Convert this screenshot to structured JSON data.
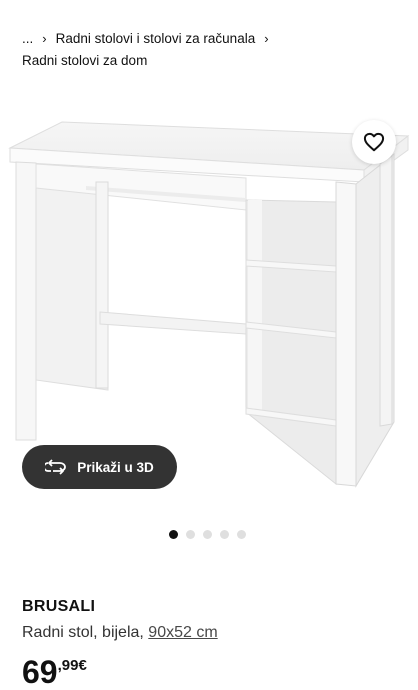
{
  "breadcrumb": {
    "ellipsis": "...",
    "separator": "›",
    "item1": "Radni stolovi i stolovi za računala",
    "item2": "Radni stolovi za dom"
  },
  "gallery": {
    "view3d_label": "Prikaži u 3D",
    "total_images": 5,
    "active_index": 0
  },
  "product": {
    "name": "BRUSALI",
    "type": "Radni stol, bijela,",
    "dimensions": "90x52 cm",
    "price_main": "69",
    "price_decimals": ",99€"
  },
  "icons": [
    "heart-icon",
    "rotate-3d-icon"
  ],
  "colors": {
    "button_dark": "#333333",
    "dot_active": "#111111",
    "dot_inactive": "#dfdfdf"
  }
}
